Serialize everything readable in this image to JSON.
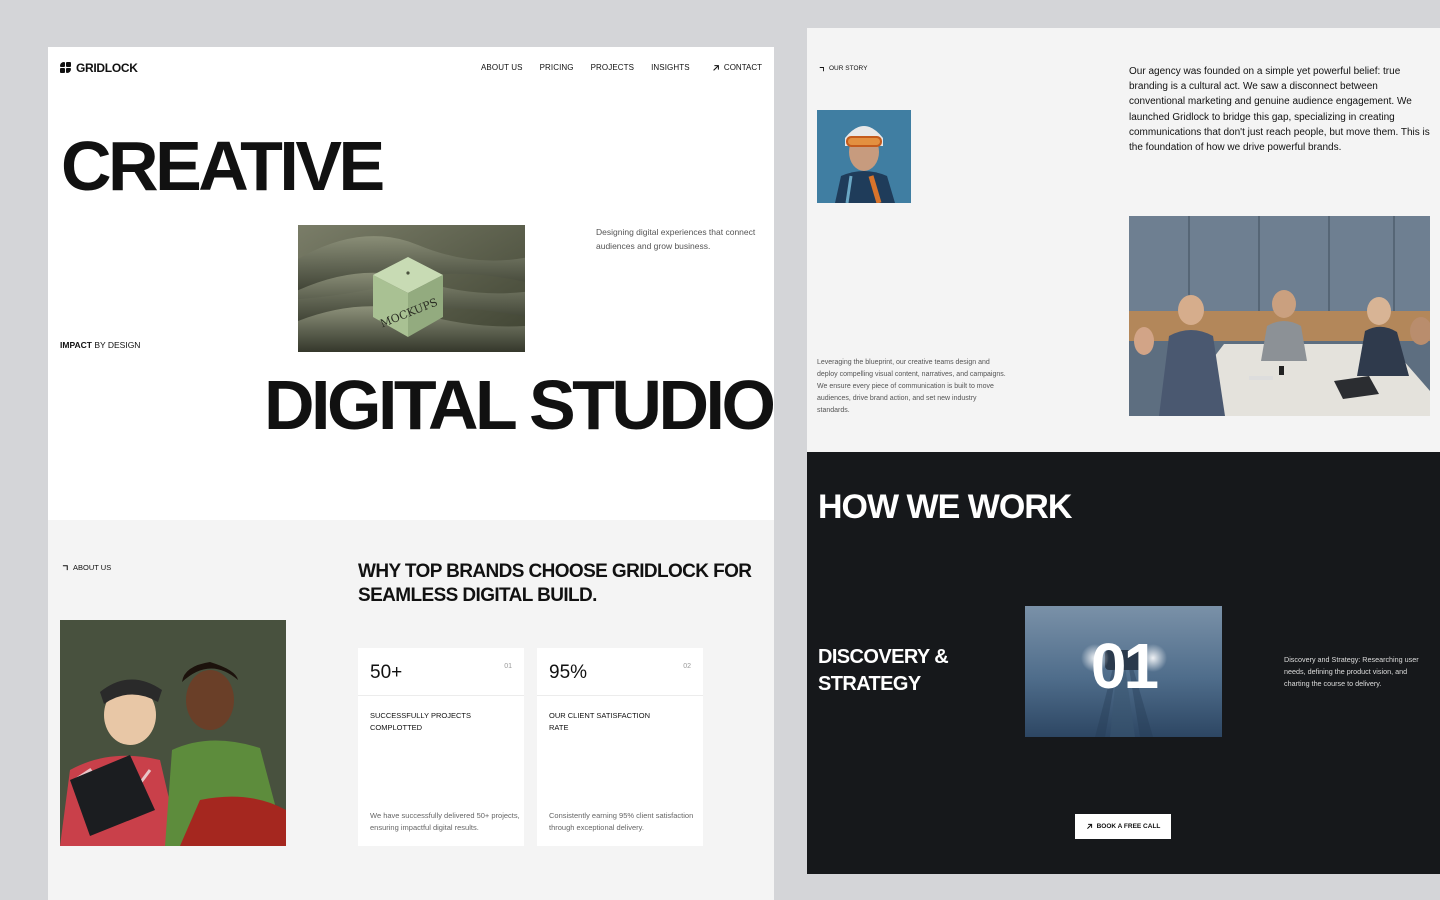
{
  "nav": {
    "logo": "GRIDLOCK",
    "links": [
      "ABOUT US",
      "PRICING",
      "PROJECTS",
      "INSIGHTS"
    ],
    "contact": "CONTACT",
    "contact_icon": "arrow-up-right-icon"
  },
  "hero": {
    "line1": "CREATIVE",
    "line2": "DIGITAL STUDIO",
    "tagline": "Designing digital experiences that connect audiences and grow business.",
    "impact_bold": "IMPACT",
    "impact_rest": " BY DESIGN",
    "image_text": "MOCKUPS"
  },
  "about": {
    "eyebrow": "ABOUT US",
    "heading": "WHY TOP BRANDS CHOOSE GRIDLOCK FOR SEAMLESS DIGITAL BUILD.",
    "stats": [
      {
        "value": "50+",
        "num": "01",
        "label": "SUCCESSFULLY PROJECTS COMPLOTTED",
        "desc": "We have successfully delivered 50+ projects, ensuring impactful digital results."
      },
      {
        "value": "95%",
        "num": "02",
        "label": "OUR CLIENT SATISFACTION RATE",
        "desc": "Consistently earning 95% client satisfaction through exceptional delivery."
      }
    ]
  },
  "story": {
    "eyebrow": "OUR STORY",
    "text": "Our agency was founded on a simple yet powerful belief: true branding is a cultural act. We saw a disconnect between conventional marketing and genuine audience engagement. We launched Gridlock to bridge this gap, specializing in creating communications that don't just reach people, but move them. This is the foundation of how we drive powerful brands.",
    "blurb": "Leveraging the blueprint, our creative teams design and deploy compelling visual content, narratives, and campaigns. We ensure every piece of communication is built to move audiences, drive brand action, and set new industry standards."
  },
  "process": {
    "title": "HOW WE WORK",
    "step_title": "DISCOVERY & STRATEGY",
    "step_number": "01",
    "step_desc": "Discovery and Strategy: Researching user needs, defining the product vision, and charting the course to delivery.",
    "cta": "BOOK A FREE CALL"
  },
  "colors": {
    "page_bg": "#d4d5d8",
    "panel_light": "#f4f4f4",
    "panel_dark": "#16181b",
    "text": "#111111"
  }
}
